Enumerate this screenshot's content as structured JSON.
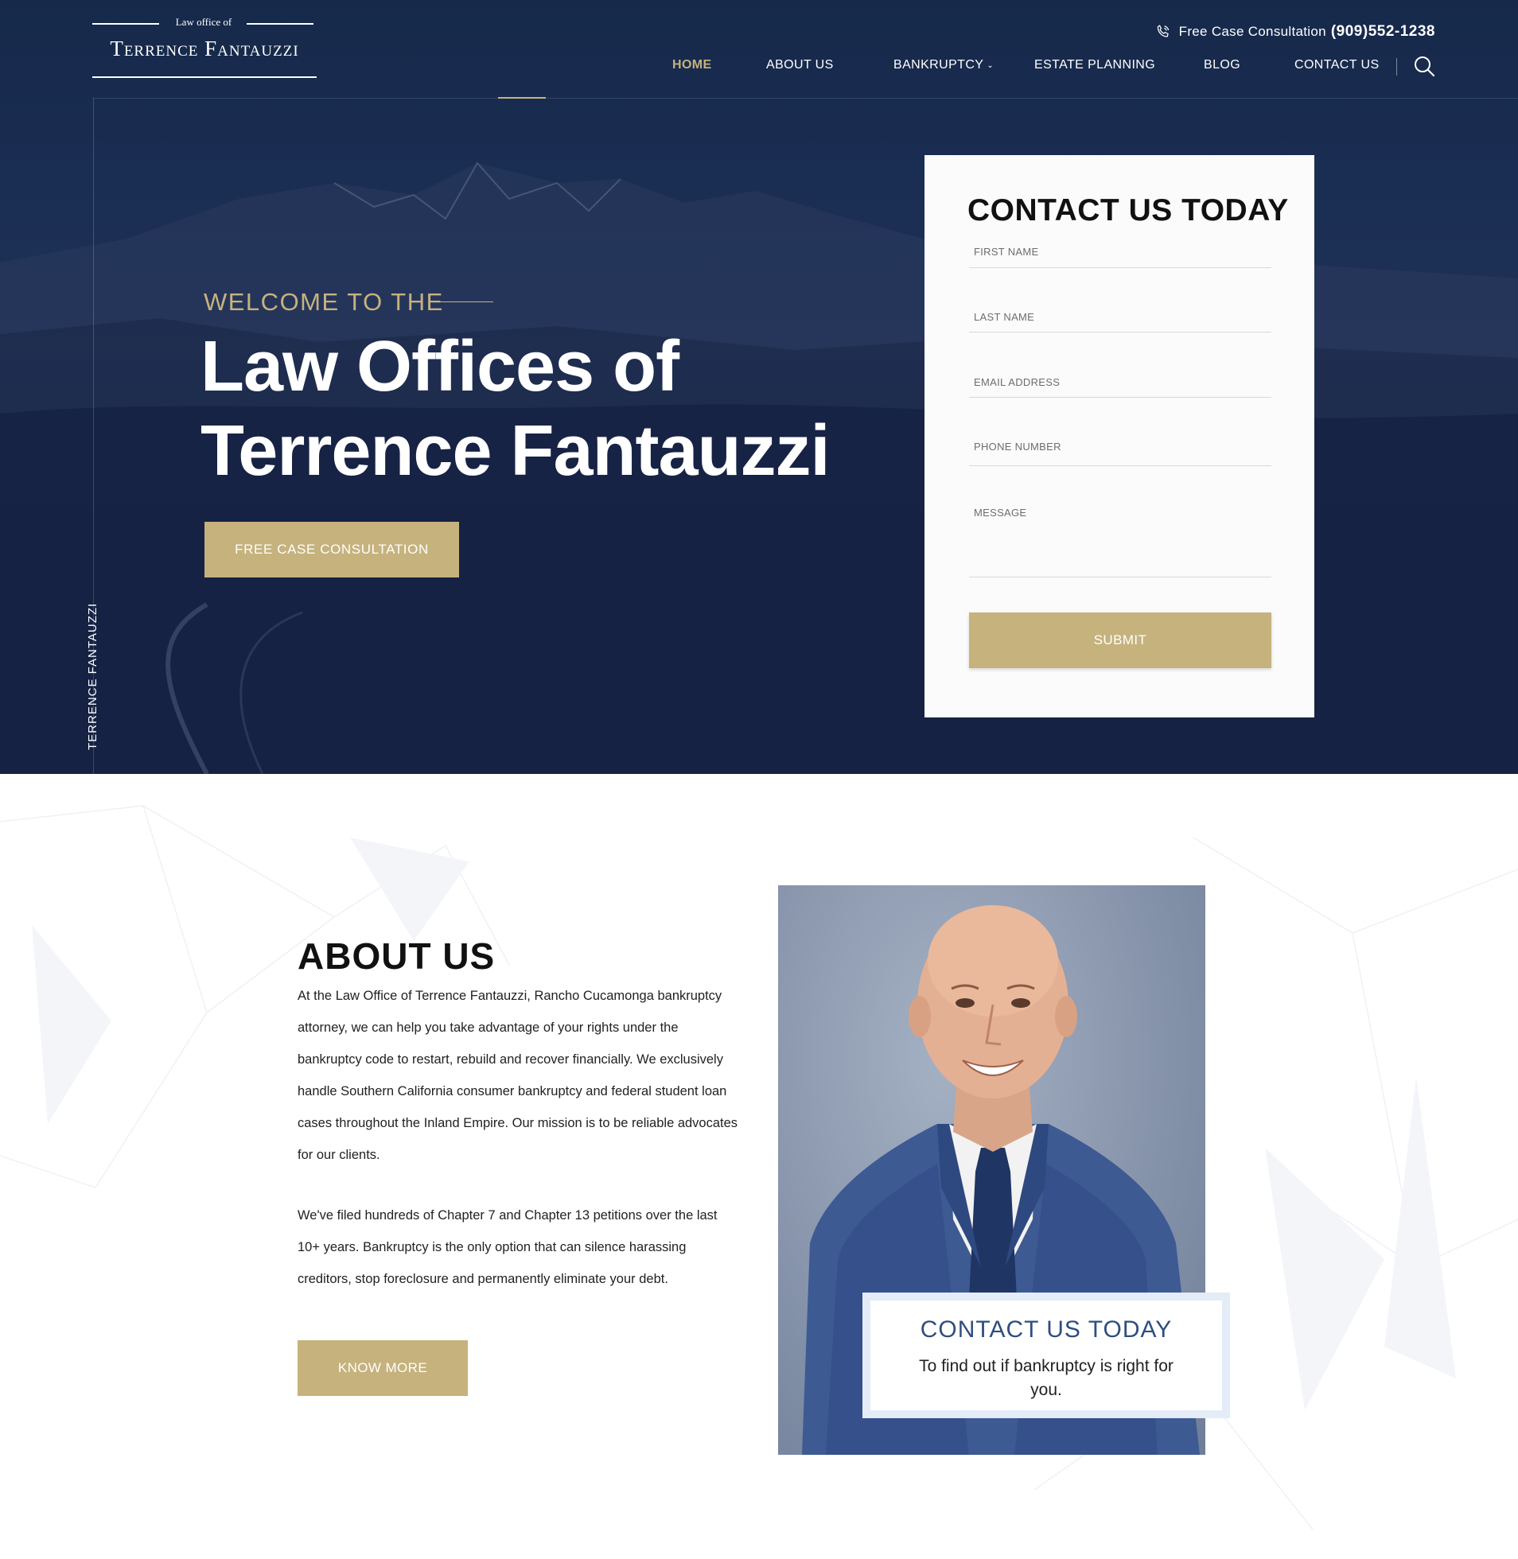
{
  "colors": {
    "gold": "#c6b27d",
    "navy": "#16294a",
    "callout_blue": "#2f4e7e"
  },
  "logo": {
    "small": "Law office of",
    "name": "Terrence Fantauzzi"
  },
  "topbar": {
    "label": "Free Case Consultation",
    "phone": "(909)552-1238",
    "icon": "phone-icon"
  },
  "nav": {
    "items": [
      {
        "label": "HOME",
        "active": true
      },
      {
        "label": "ABOUT US",
        "active": false
      },
      {
        "label": "BANKRUPTCY",
        "active": false
      },
      {
        "label": "ESTATE PLANNING",
        "active": false
      },
      {
        "label": "BLOG",
        "active": false
      },
      {
        "label": "CONTACT US",
        "active": false
      }
    ],
    "search_icon": "search-icon",
    "dropdown_icon": "chevron-down-icon"
  },
  "hero": {
    "welcome": "WELCOME TO THE",
    "title_line1": "Law Offices of",
    "title_line2": "Terrence Fantauzzi",
    "cta": "FREE CASE CONSULTATION",
    "vertical_text": "TERRENCE FANTAUZZI"
  },
  "form": {
    "title": "CONTACT US TODAY",
    "fields": {
      "first_name": "FIRST NAME",
      "last_name": "LAST NAME",
      "email": "EMAIL ADDRESS",
      "phone": "PHONE NUMBER",
      "message": "MESSAGE"
    },
    "submit": "SUBMIT"
  },
  "about": {
    "title": "ABOUT US",
    "p1": "At the Law Office of Terrence Fantauzzi, Rancho Cucamonga bankruptcy attorney, we can help you take advantage of your rights under the bankruptcy code to restart, rebuild and recover financially. We exclusively handle Southern California consumer bankruptcy and federal student loan cases throughout the Inland Empire. Our mission is to be reliable advocates for our clients.",
    "p2": "We've filed hundreds of Chapter 7 and Chapter 13 petitions over the last 10+ years. Bankruptcy is the only option that can silence harassing creditors, stop foreclosure and permanently eliminate your debt.",
    "button": "KNOW MORE",
    "callout_title": "CONTACT US TODAY",
    "callout_sub": "To find out if bankruptcy is right for you."
  }
}
